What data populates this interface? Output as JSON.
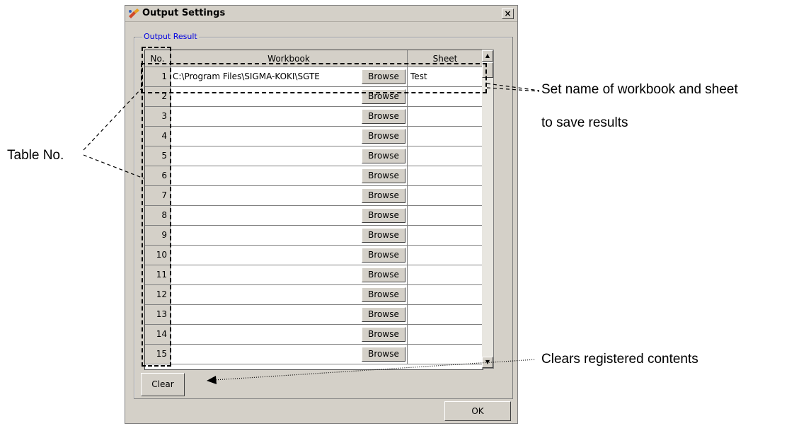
{
  "window": {
    "title": "Output Settings",
    "close_symbol": "×"
  },
  "group": {
    "label": "Output Result"
  },
  "table": {
    "headers": {
      "no": "No.",
      "workbook": "Workbook",
      "sheet": "Sheet"
    },
    "rows": [
      {
        "no": "1",
        "workbook": "C:\\Program Files\\SIGMA-KOKI\\SGTE",
        "browse": "Browse",
        "sheet": "Test"
      },
      {
        "no": "2",
        "workbook": "",
        "browse": "Browse",
        "sheet": ""
      },
      {
        "no": "3",
        "workbook": "",
        "browse": "Browse",
        "sheet": ""
      },
      {
        "no": "4",
        "workbook": "",
        "browse": "Browse",
        "sheet": ""
      },
      {
        "no": "5",
        "workbook": "",
        "browse": "Browse",
        "sheet": ""
      },
      {
        "no": "6",
        "workbook": "",
        "browse": "Browse",
        "sheet": ""
      },
      {
        "no": "7",
        "workbook": "",
        "browse": "Browse",
        "sheet": ""
      },
      {
        "no": "8",
        "workbook": "",
        "browse": "Browse",
        "sheet": ""
      },
      {
        "no": "9",
        "workbook": "",
        "browse": "Browse",
        "sheet": ""
      },
      {
        "no": "10",
        "workbook": "",
        "browse": "Browse",
        "sheet": ""
      },
      {
        "no": "11",
        "workbook": "",
        "browse": "Browse",
        "sheet": ""
      },
      {
        "no": "12",
        "workbook": "",
        "browse": "Browse",
        "sheet": ""
      },
      {
        "no": "13",
        "workbook": "",
        "browse": "Browse",
        "sheet": ""
      },
      {
        "no": "14",
        "workbook": "",
        "browse": "Browse",
        "sheet": ""
      },
      {
        "no": "15",
        "workbook": "",
        "browse": "Browse",
        "sheet": ""
      }
    ]
  },
  "buttons": {
    "clear": "Clear",
    "ok": "OK"
  },
  "annotations": {
    "table_no": "Table No.",
    "set_name_line1": "Set name of workbook and sheet",
    "set_name_line2": "to save results",
    "clears": "Clears registered contents"
  },
  "icons": {
    "title_icon": "satellite-icon",
    "scroll_up": "arrow-up-icon",
    "scroll_down": "arrow-down-icon"
  },
  "colors": {
    "dialog_bg": "#d4d0c8",
    "group_label": "#0000e0"
  }
}
